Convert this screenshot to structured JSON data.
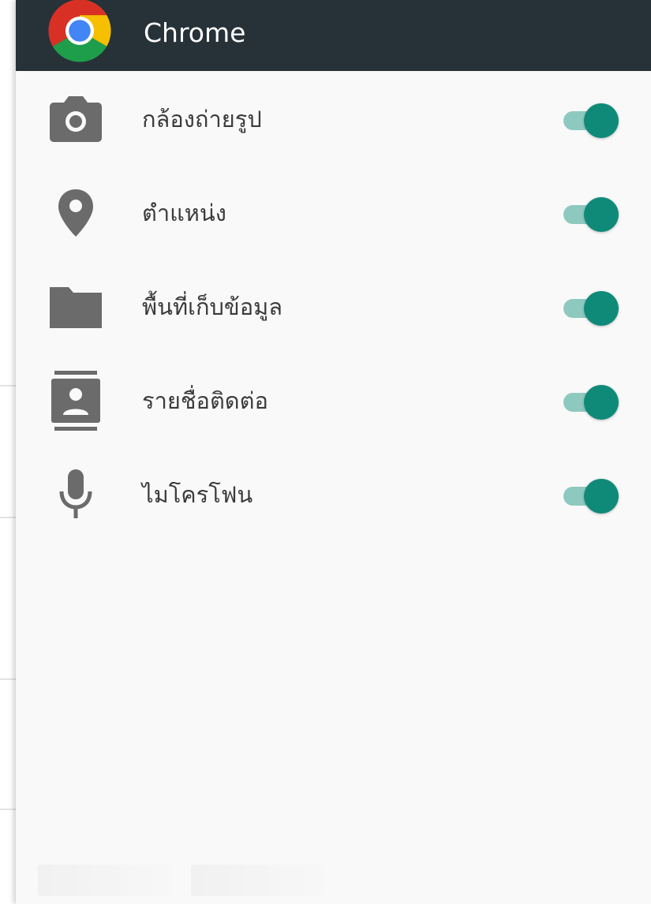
{
  "header": {
    "app_name": "Chrome",
    "app_icon": "chrome-logo-icon",
    "background_color": "#263238"
  },
  "permissions": [
    {
      "label": "กล้องถ่ายรูป",
      "icon": "camera-icon",
      "enabled": true
    },
    {
      "label": "ตำแหน่ง",
      "icon": "location-pin-icon",
      "enabled": true
    },
    {
      "label": "พื้นที่เก็บข้อมูล",
      "icon": "folder-icon",
      "enabled": true
    },
    {
      "label": "รายชื่อติดต่อ",
      "icon": "contacts-icon",
      "enabled": true
    },
    {
      "label": "ไมโครโฟน",
      "icon": "microphone-icon",
      "enabled": true
    }
  ],
  "colors": {
    "toggle_on_thumb": "#0f8a79",
    "toggle_on_track": "#8ec9bf",
    "icon_gray": "#6b6b6b",
    "sheet_background": "#f9f9f9"
  }
}
